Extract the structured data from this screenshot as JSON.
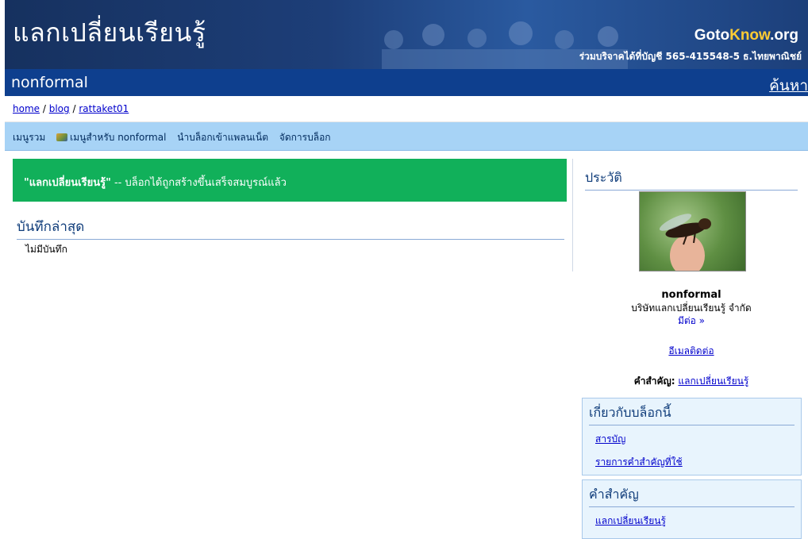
{
  "header": {
    "site_title": "แลกเปลี่ยนเรียนรู้",
    "brand_goto": "Goto",
    "brand_know": "Know",
    "brand_org": ".org",
    "donate_text": "ร่วมบริจาคได้ที่บัญชี 565-415548-5 ธ.ไทยพาณิชย์"
  },
  "blogbar": {
    "blog_name": "nonformal",
    "search_label": "ค้นหา"
  },
  "breadcrumb": {
    "home": "home",
    "blog": "blog",
    "user": "rattaket01",
    "separator": "/"
  },
  "menu": {
    "main_menu": "เมนูรวม",
    "user_menu": "เมนูสำหรับ nonformal",
    "planet": "นำบล็อกเข้าแพลนเน็ต",
    "manage": "จัดการบล็อก"
  },
  "main": {
    "notice_title": "\"แลกเปลี่ยนเรียนรู้\"",
    "notice_text": " -- บล็อกได้ถูกสร้างขึ้นเสร็จสมบูรณ์แล้ว",
    "latest_title": "บันทึกล่าสุด",
    "no_entries": "ไม่มีบันทึก"
  },
  "sidebar": {
    "profile_title": "ประวัติ",
    "profile_name": "nonformal",
    "profile_org": "บริษัทแลกเปลี่ยนเรียนรู้ จำกัด",
    "more_link": "มีต่อ »",
    "email_link": "อีเมลติดต่อ",
    "keywords_label": "คำสำคัญ:",
    "keywords_value": "แลกเปลี่ยนเรียนรู้",
    "about_box": {
      "title": "เกี่ยวกับบล็อกนี้",
      "items": [
        "สารบัญ",
        "รายการคำสำคัญที่ใช้"
      ]
    },
    "keywords_box": {
      "title": "คำสำคัญ",
      "items": [
        "แลกเปลี่ยนเรียนรู้"
      ]
    }
  },
  "colors": {
    "banner": "#1d3e78",
    "blogbar": "#0e3f8e",
    "menubar": "#a7d3f6",
    "notice": "#11b05a",
    "link": "#0000cc"
  }
}
